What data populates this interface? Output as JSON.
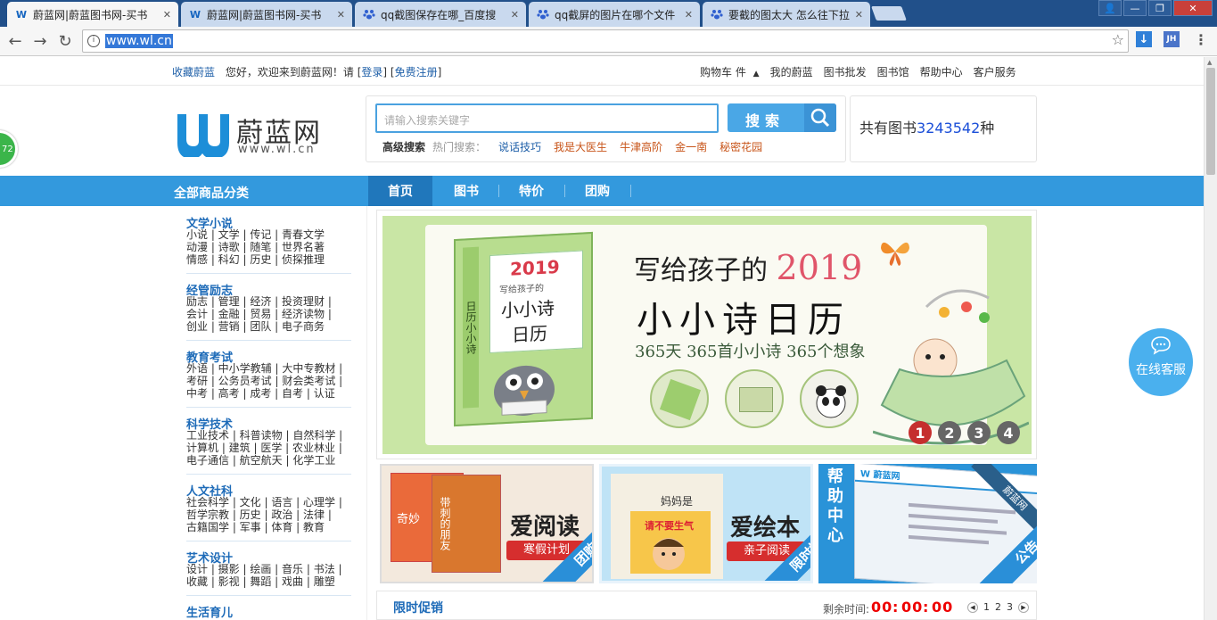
{
  "browser": {
    "tabs": [
      {
        "title": "蔚蓝网|蔚蓝图书网-买书",
        "icon": "wl-favicon",
        "active": true
      },
      {
        "title": "蔚蓝网|蔚蓝图书网-买书",
        "icon": "wl-favicon",
        "active": false
      },
      {
        "title": "qq截图保存在哪_百度搜",
        "icon": "baidu-paw-icon",
        "active": false
      },
      {
        "title": "qq截屏的图片在哪个文件",
        "icon": "baidu-paw-icon",
        "active": false
      },
      {
        "title": "要截的图太大 怎么往下拉",
        "icon": "baidu-paw-icon",
        "active": false
      }
    ],
    "url": "www.wl.cn",
    "extensions": {
      "download": "↓",
      "jh": "JH"
    }
  },
  "topbar": {
    "fav": "收藏蔚蓝",
    "welcome": "您好，欢迎来到蔚蓝网！请",
    "login": "登录",
    "register": "免费注册",
    "cart": "购物车 件",
    "links": [
      "我的蔚蓝",
      "图书批发",
      "图书馆",
      "帮助中心",
      "客户服务"
    ]
  },
  "logo": {
    "name": "蔚蓝网",
    "url": "www.wl.cn"
  },
  "search": {
    "placeholder": "请输入搜索关键字",
    "button": "搜索",
    "advanced": "高级搜索",
    "hot_label": "热门搜索：",
    "hot": [
      {
        "text": "说话技巧",
        "color": "#1e5fa8"
      },
      {
        "text": "我是大医生",
        "color": "#c8551a"
      },
      {
        "text": "牛津高阶",
        "color": "#c8551a"
      },
      {
        "text": "金一南",
        "color": "#c8551a"
      },
      {
        "text": "秘密花园",
        "color": "#c8551a"
      }
    ]
  },
  "book_count": {
    "prefix": "共有图书",
    "number": "3243542",
    "suffix": "种"
  },
  "nav": {
    "all_categories": "全部商品分类",
    "items": [
      "首页",
      "图书",
      "特价",
      "团购"
    ]
  },
  "categories": [
    {
      "title": "文学小说",
      "rows": [
        "小说 | 文学 | 传记 | 青春文学",
        "动漫 | 诗歌 | 随笔 | 世界名著",
        "情感 | 科幻 | 历史 | 侦探推理"
      ]
    },
    {
      "title": "经管励志",
      "rows": [
        "励志 | 管理 | 经济 | 投资理财 |",
        "会计 | 金融 | 贸易 | 经济读物 |",
        "创业 | 营销 | 团队 | 电子商务"
      ]
    },
    {
      "title": "教育考试",
      "rows": [
        "外语 | 中小学教辅 | 大中专教材 |",
        "考研 | 公务员考试 | 财会类考试 |",
        "中考 | 高考 | 成考 | 自考 | 认证"
      ]
    },
    {
      "title": "科学技术",
      "rows": [
        "工业技术 | 科普读物 | 自然科学 |",
        "计算机 | 建筑 | 医学 | 农业林业 |",
        "电子通信 | 航空航天 | 化学工业"
      ]
    },
    {
      "title": "人文社科",
      "rows": [
        "社会科学 | 文化 | 语言 | 心理学 |",
        "哲学宗教 | 历史 | 政治 | 法律 |",
        "古籍国学 | 军事 | 体育 | 教育"
      ]
    },
    {
      "title": "艺术设计",
      "rows": [
        "设计 | 摄影 | 绘画 | 音乐 | 书法 |",
        "收藏 | 影视 | 舞蹈 | 戏曲 | 雕塑"
      ]
    },
    {
      "title": "生活育儿",
      "rows": []
    }
  ],
  "banner": {
    "headline_prefix": "写给孩子的",
    "year": "2019",
    "title": "小小诗日历",
    "subtitle": "365天  365首小小诗  365个想象",
    "book_year": "2019",
    "book_label": "写给孩子的",
    "book_title_1": "小小诗",
    "book_title_2": "日历",
    "book_spine": "日历小小诗",
    "slides": [
      "1",
      "2",
      "3",
      "4"
    ],
    "active_slide": 1
  },
  "promos": [
    {
      "title": "爱阅读",
      "ribbon": "寒假计划",
      "corner": "团购",
      "book_a": "奇妙",
      "book_b": "带刺的朋友"
    },
    {
      "title": "爱绘本",
      "ribbon": "亲子阅读",
      "corner": "限时抢",
      "book_a": "妈妈是",
      "book_b": "请不要生气"
    },
    {
      "title": "帮助中心",
      "corner": "公告",
      "site": "蔚蓝网"
    }
  ],
  "flash_sale": {
    "title": "限时促销",
    "remaining": "剩余时间:",
    "hh": "00",
    "mm": "00",
    "ss": "00",
    "pages": [
      "1",
      "2",
      "3"
    ]
  },
  "float": {
    "service": "在线客服",
    "badge": "72"
  },
  "colors": {
    "accent": "#3399dd",
    "brand_blue": "#1e6bb8",
    "countdown": "#ee0000"
  }
}
